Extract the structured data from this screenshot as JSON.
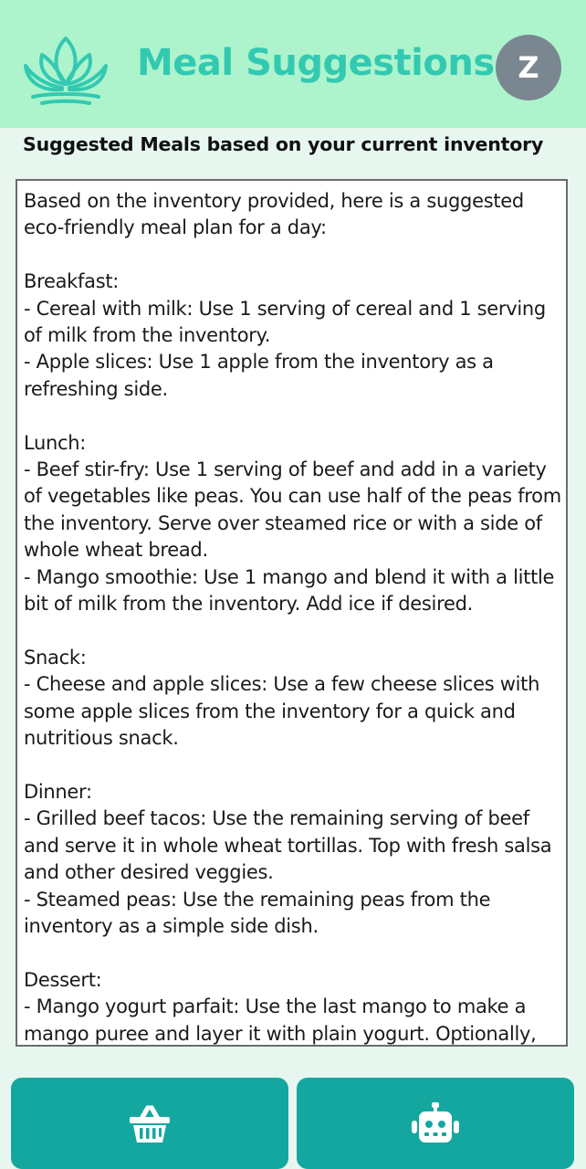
{
  "header": {
    "title": "Meal Suggestions",
    "logo_icon": "lotus-icon",
    "avatar_letter": "Z"
  },
  "subheading": "Suggested Meals based on your current inventory",
  "suggestion": {
    "text": "Based on the inventory provided, here is a suggested eco-friendly meal plan for a day:\n\nBreakfast:\n- Cereal with milk: Use 1 serving of cereal and 1 serving of milk from the inventory.\n- Apple slices: Use 1 apple from the inventory as a refreshing side.\n\nLunch:\n- Beef stir-fry: Use 1 serving of beef and add in a variety of vegetables like peas. You can use half of the peas from the inventory. Serve over steamed rice or with a side of whole wheat bread.\n- Mango smoothie: Use 1 mango and blend it with a little bit of milk from the inventory. Add ice if desired.\n\nSnack:\n- Cheese and apple slices: Use a few cheese slices with some apple slices from the inventory for a quick and nutritious snack.\n\nDinner:\n- Grilled beef tacos: Use the remaining serving of beef and serve it in whole wheat tortillas. Top with fresh salsa and other desired veggies.\n- Steamed peas: Use the remaining peas from the inventory as a simple side dish.\n\nDessert:\n- Mango yogurt parfait: Use the last mango to make a mango puree and layer it with plain yogurt. Optionally,"
  },
  "nav": {
    "inventory_icon": "basket-icon",
    "assistant_icon": "robot-icon"
  },
  "colors": {
    "header_bg": "#adf4cd",
    "title": "#33c9b1",
    "avatar_bg": "#7b8790",
    "button_bg": "#14a7a0",
    "page_bg": "#e7f7ef"
  }
}
